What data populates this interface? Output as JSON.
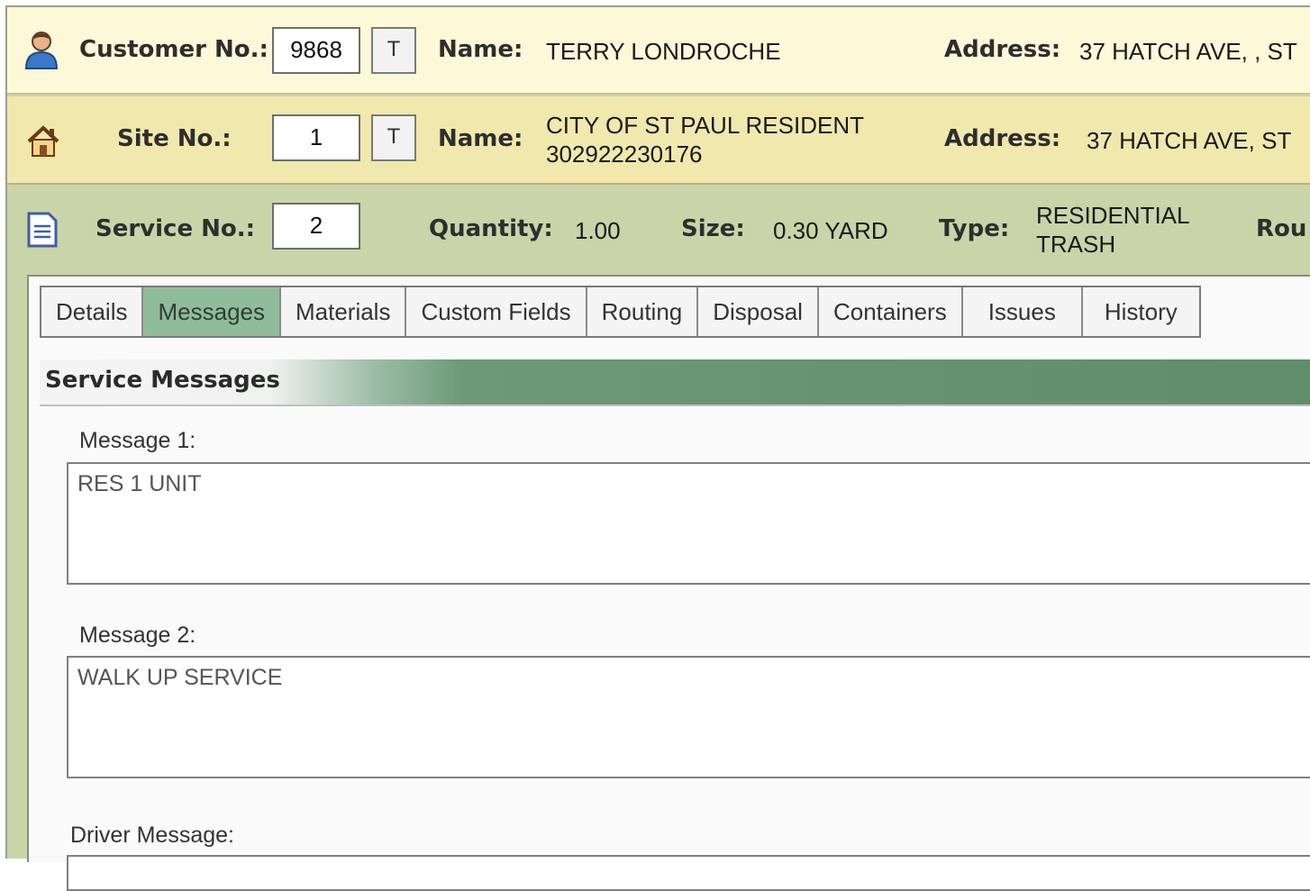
{
  "customer": {
    "number_label": "Customer No.:",
    "number_value": "9868",
    "t_button": "T",
    "name_label": "Name:",
    "name_value": "TERRY LONDROCHE",
    "address_label": "Address:",
    "address_value": "37 HATCH AVE, , ST"
  },
  "site": {
    "number_label": "Site No.:",
    "number_value": "1",
    "t_button": "T",
    "name_label": "Name:",
    "name_line1": "CITY OF ST PAUL RESIDENT",
    "name_line2": "302922230176",
    "address_label": "Address:",
    "address_value": "37 HATCH AVE, ST"
  },
  "service": {
    "number_label": "Service No.:",
    "number_value": "2",
    "quantity_label": "Quantity:",
    "quantity_value": "1.00",
    "size_label": "Size:",
    "size_value": "0.30 YARD",
    "type_label": "Type:",
    "type_line1": "RESIDENTIAL",
    "type_line2": "TRASH",
    "route_label": "Rou"
  },
  "tabs": [
    {
      "label": "Details"
    },
    {
      "label": "Messages"
    },
    {
      "label": "Materials"
    },
    {
      "label": "Custom Fields"
    },
    {
      "label": "Routing"
    },
    {
      "label": "Disposal"
    },
    {
      "label": "Containers"
    },
    {
      "label": "Issues"
    },
    {
      "label": "History"
    }
  ],
  "active_tab": "Messages",
  "messages": {
    "section_title": "Service Messages",
    "message1_label": "Message 1:",
    "message1_value": "RES 1 UNIT",
    "message2_label": "Message 2:",
    "message2_value": "WALK UP SERVICE",
    "driver_label": "Driver Message:"
  },
  "colors": {
    "customer_band": "#fcf8d8",
    "site_band": "#f0e8ad",
    "service_band": "#c9d4a8",
    "active_tab": "#8fbc9a",
    "header_green": "#5f8d6b"
  },
  "icons": {
    "customer": "person-icon",
    "site": "house-icon",
    "service": "document-icon"
  }
}
